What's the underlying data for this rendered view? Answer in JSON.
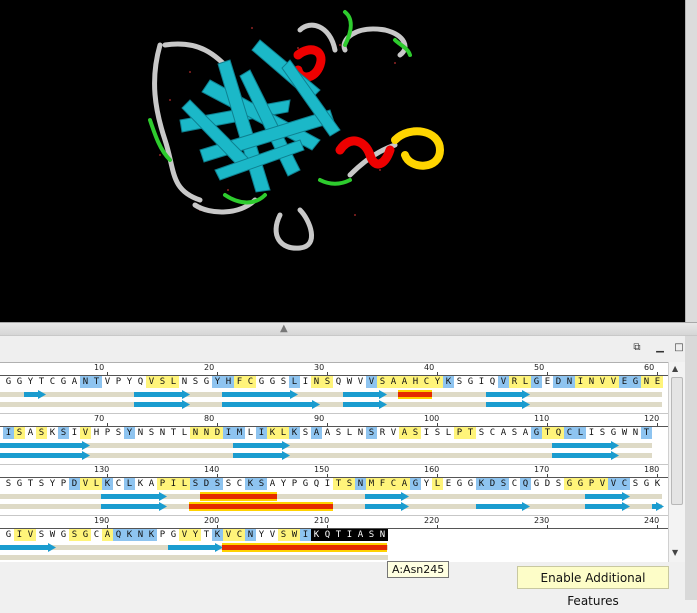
{
  "viewer": {
    "label": "3D protein structure view"
  },
  "panel_buttons": {
    "restore_icon": "restore-icon",
    "minimize_icon": "minimize-icon",
    "maximize_icon": "maximize-icon"
  },
  "sequence": {
    "rows": [
      {
        "start": 1,
        "residues": "GGYTCGANTVPYQVSLNSGYHFCGGSLINSQWVVSAAHCYKSGIQVRLGEDNINVVEGNE",
        "hl_y": [
          13,
          14,
          15,
          20,
          21,
          22,
          28,
          29,
          34,
          35,
          36,
          37,
          38,
          39,
          46,
          47,
          52,
          53,
          54,
          55,
          58,
          59
        ],
        "hl_b": [
          7,
          8,
          19,
          20,
          26,
          33,
          40,
          45,
          48,
          50,
          51,
          56,
          57
        ],
        "ticks": [
          10,
          20,
          30,
          40,
          50,
          60
        ]
      },
      {
        "start": 61,
        "residues": "ISASKSIVHPSYNSNTLNNDIMLIKLKSAASLNSRVASISLPTSCASAGTQCLISGWNT",
        "hl_y": [
          1,
          3,
          7,
          17,
          18,
          19,
          24,
          25,
          36,
          37,
          41,
          42,
          49,
          50
        ],
        "hl_b": [
          0,
          5,
          11,
          20,
          21,
          23,
          26,
          28,
          33,
          48,
          51,
          52,
          58
        ],
        "ticks": [
          70,
          80,
          90,
          100,
          110,
          120
        ]
      },
      {
        "start": 121,
        "residues": "SGTSYPDVLKCLKAPILSDSSCKSAYPGQITSNMFCAGYLEGGKDSCQGDSGGPVVCSGK",
        "hl_y": [
          7,
          8,
          14,
          15,
          16,
          30,
          31,
          33,
          34,
          35,
          36,
          39,
          51,
          52,
          53,
          54
        ],
        "hl_b": [
          6,
          9,
          11,
          17,
          18,
          19,
          22,
          23,
          32,
          37,
          43,
          44,
          45,
          47,
          55,
          56
        ],
        "ticks": [
          130,
          140,
          150,
          160,
          170,
          180
        ]
      },
      {
        "start": 181,
        "residues": "GIVSWGSGCAQKNKPGVYTKVCNYVSWIKQTIASN",
        "hl_y": [
          1,
          2,
          6,
          7,
          9,
          16,
          17,
          20,
          21,
          22,
          25,
          26
        ],
        "hl_b": [
          10,
          11,
          12,
          13,
          19,
          22,
          27
        ],
        "sel": [
          28,
          29,
          30,
          31,
          32,
          33,
          34
        ],
        "ticks": [
          190,
          200,
          210,
          220,
          230,
          240
        ]
      }
    ]
  },
  "tooltip": {
    "text": "A:Asn245"
  },
  "features_button": {
    "label": "Enable Additional Features"
  }
}
